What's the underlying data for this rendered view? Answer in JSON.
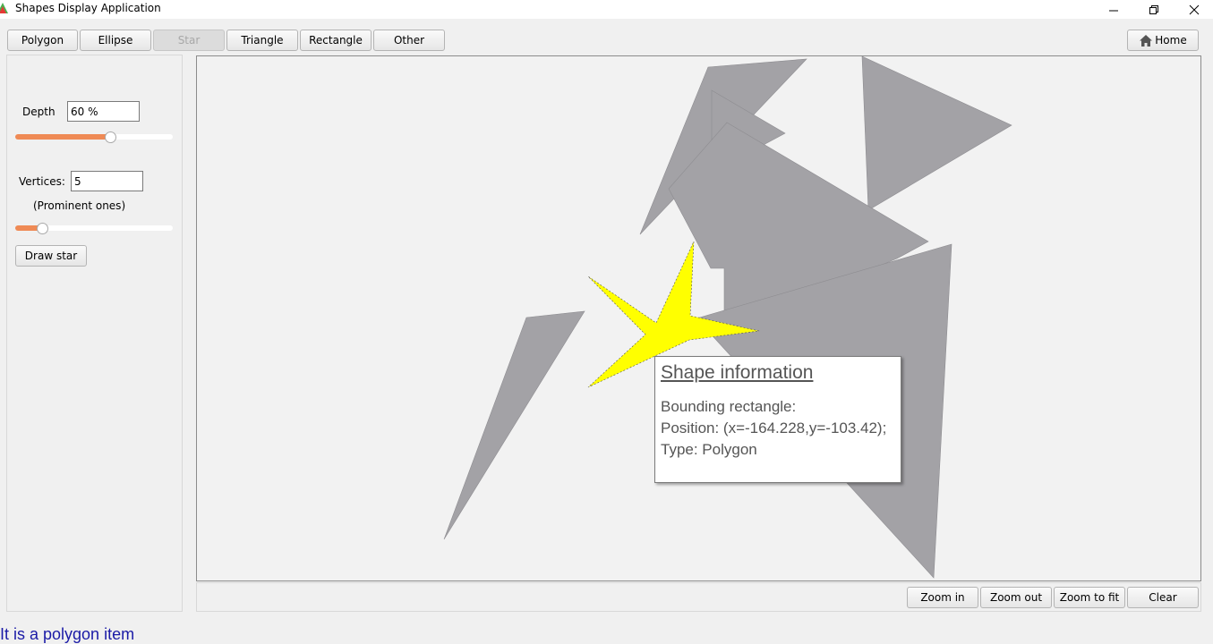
{
  "window": {
    "title": "Shapes Display Application",
    "min_icon": "minimize-icon",
    "max_icon": "restore-icon",
    "close_icon": "close-icon"
  },
  "toolbar": {
    "polygon": "Polygon",
    "ellipse": "Ellipse",
    "star": "Star",
    "triangle": "Triangle",
    "rectangle": "Rectangle",
    "other": "Other",
    "home": "Home"
  },
  "star_panel": {
    "depth_label": "Depth",
    "depth_value": "60 %",
    "depth_level": 0.6,
    "vertices_label": "Vertices:",
    "vertices_value": "5",
    "vertices_note": "(Prominent ones)",
    "vertices_level": 0.17,
    "draw_button": "Draw star"
  },
  "tooltip": {
    "title": "Shape information",
    "line1": "Bounding rectangle:",
    "line2": "Position: (x=-164.228,y=-103.42);",
    "line3": "Type: Polygon"
  },
  "zoom_bar": {
    "zoom_in": "Zoom in",
    "zoom_out": "Zoom out",
    "zoom_fit": "Zoom to fit",
    "clear": "Clear"
  },
  "status": "It is a polygon item",
  "colors": {
    "shape_fill": "#a3a2a6",
    "star_fill": "#ffff00",
    "slider_accent": "#ef8a55",
    "status_text": "#1a1aa6"
  }
}
